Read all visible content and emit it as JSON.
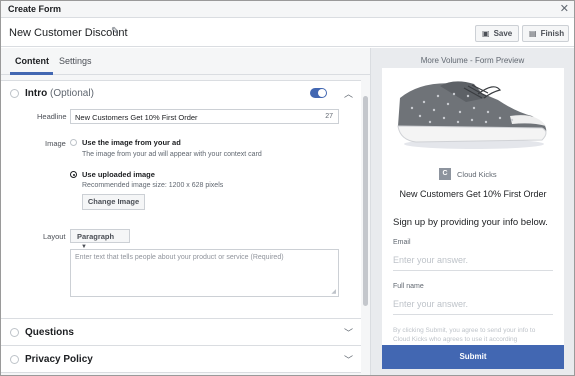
{
  "window": {
    "title": "Create Form",
    "close_icon": "close-icon"
  },
  "header": {
    "form_name": "New Customer Discount",
    "save_label": "Save",
    "finish_label": "Finish"
  },
  "tabs": [
    {
      "label": "Content",
      "active": true
    },
    {
      "label": "Settings",
      "active": false
    }
  ],
  "intro": {
    "title": "Intro",
    "optional": "(Optional)",
    "enabled": true,
    "headline_label": "Headline",
    "headline_value": "New Customers Get 10% First Order",
    "headline_count": "27",
    "image_label": "Image",
    "image_option_1_title": "Use the image from your ad",
    "image_option_1_desc": "The image from your ad will appear with your context card",
    "image_option_2_title": "Use uploaded image",
    "image_option_2_desc": "Recommended image size: 1200 x 628 pixels",
    "change_image_label": "Change Image",
    "layout_label": "Layout",
    "layout_value": "Paragraph",
    "description_placeholder": "Enter text that tells people about your product or service (Required)"
  },
  "sections": {
    "questions": "Questions",
    "privacy": "Privacy Policy"
  },
  "preview": {
    "title": "More Volume - Form Preview",
    "brand_initial": "C",
    "brand_name": "Cloud Kicks",
    "headline": "New Customers Get 10% First Order",
    "intro_text": "Sign up by providing your info below.",
    "email_label": "Email",
    "email_placeholder": "Enter your answer.",
    "fullname_label": "Full name",
    "fullname_placeholder": "Enter your answer.",
    "disclaimer": "By clicking Submit, you agree to send your info to Cloud Kicks who agrees to use it according",
    "submit_label": "Submit"
  },
  "colors": {
    "accent": "#4267b2",
    "panel_bg": "#f5f6f7",
    "preview_bg": "#e9ebee"
  }
}
